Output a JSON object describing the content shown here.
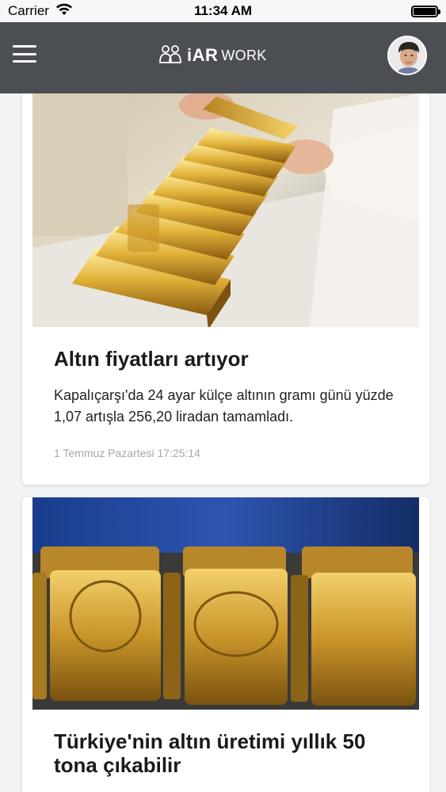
{
  "status_bar": {
    "carrier": "Carrier",
    "time": "11:34 AM",
    "wifi_icon": "wifi-icon",
    "battery_icon": "battery-icon"
  },
  "nav": {
    "menu_icon": "hamburger-menu-icon",
    "logo_bold": "iAR",
    "logo_light": "WORK",
    "logo_icon": "people-group-icon",
    "avatar": "user-avatar",
    "background_color": "#4b4f53"
  },
  "articles": [
    {
      "image": "gold-bars-stack-photo",
      "title": "Altın fiyatları artıyor",
      "summary": "Kapalıçarşı'da 24 ayar külçe altının gramı günü yüzde 1,07 artışla 256,20 liradan tamamladı.",
      "date": "1 Temmuz Pazartesi 17:25:14"
    },
    {
      "image": "gold-bars-1000g-photo",
      "title": "Türkiye'nin altın üretimi yıllık 50 tona çıkabilir"
    }
  ]
}
